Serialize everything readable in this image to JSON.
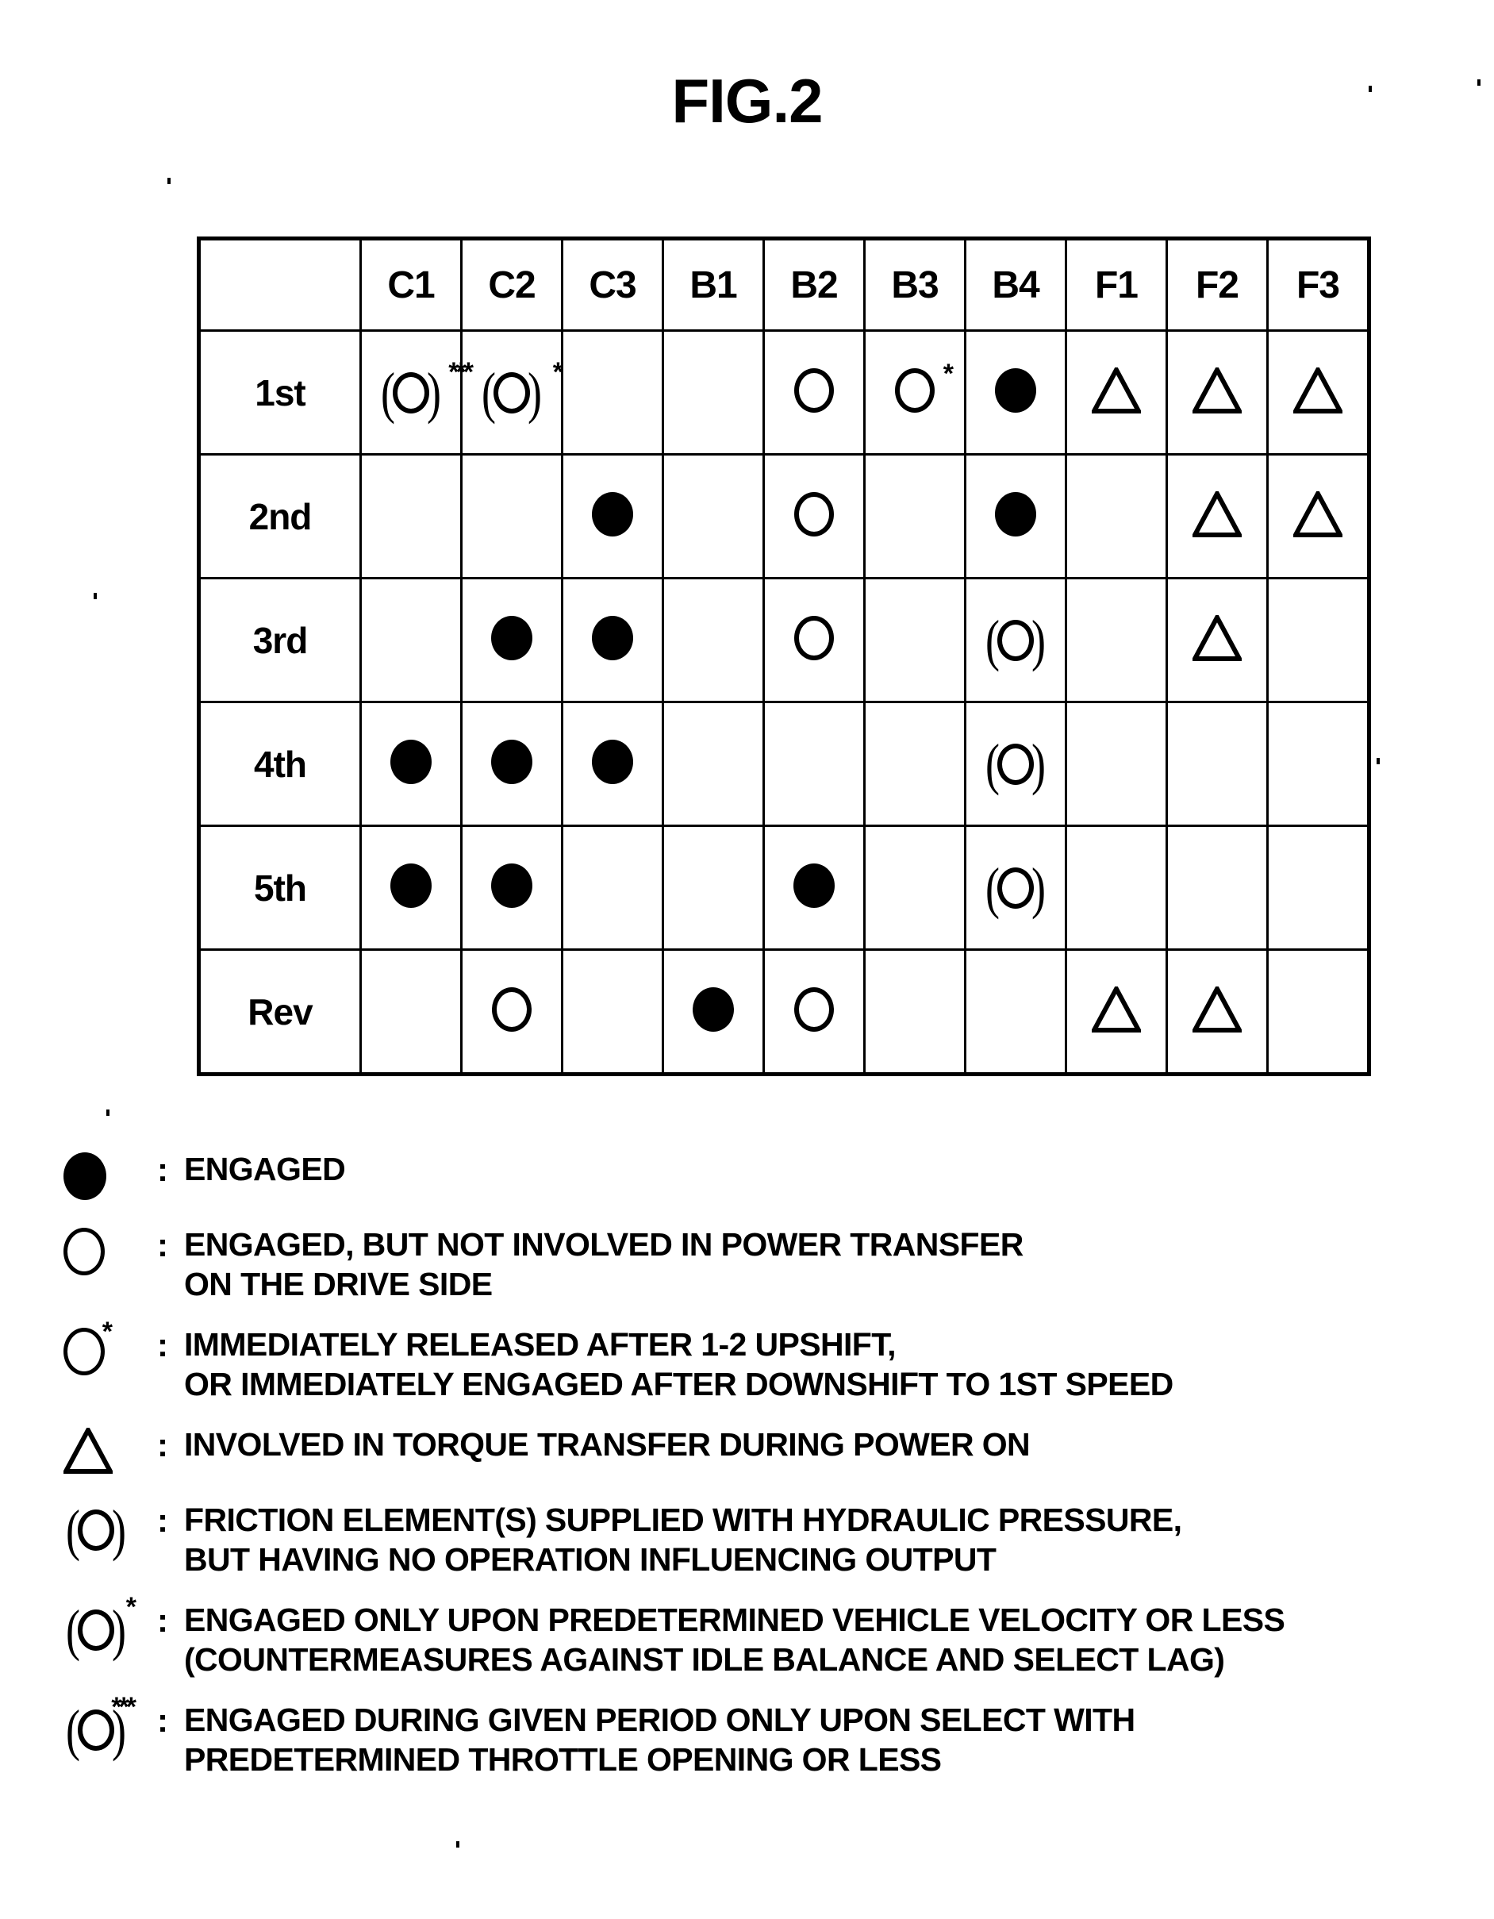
{
  "figure": {
    "title": "FIG.2"
  },
  "table": {
    "corner_label": "",
    "columns": [
      "C1",
      "C2",
      "C3",
      "B1",
      "B2",
      "B3",
      "B4",
      "F1",
      "F2",
      "F3"
    ],
    "row_labels": [
      "1st",
      "2nd",
      "3rd",
      "4th",
      "5th",
      "Rev"
    ],
    "symbol_legend_keys": {
      "filled": "filled-circle",
      "open": "open-circle",
      "open_star": "open-circle-asterisk",
      "triangle": "triangle",
      "paren": "paren-circle",
      "paren_star": "paren-circle-asterisk",
      "paren_star3": "paren-circle-triple-asterisk",
      "empty": ""
    },
    "rows": [
      {
        "label": "1st",
        "cells": [
          "paren_star3",
          "paren_star",
          "",
          "",
          "open",
          "open_star",
          "filled",
          "triangle",
          "triangle",
          "triangle"
        ]
      },
      {
        "label": "2nd",
        "cells": [
          "",
          "",
          "filled",
          "",
          "open",
          "",
          "filled",
          "",
          "triangle",
          "triangle"
        ]
      },
      {
        "label": "3rd",
        "cells": [
          "",
          "filled",
          "filled",
          "",
          "open",
          "",
          "paren",
          "",
          "triangle",
          ""
        ]
      },
      {
        "label": "4th",
        "cells": [
          "filled",
          "filled",
          "filled",
          "",
          "",
          "",
          "paren",
          "",
          "",
          ""
        ]
      },
      {
        "label": "5th",
        "cells": [
          "filled",
          "filled",
          "",
          "",
          "filled",
          "",
          "paren",
          "",
          "",
          ""
        ]
      },
      {
        "label": "Rev",
        "cells": [
          "",
          "open",
          "",
          "filled",
          "open",
          "",
          "",
          "triangle",
          "triangle",
          ""
        ]
      }
    ]
  },
  "legend": {
    "colon": ":",
    "items": [
      {
        "symbol": "filled-circle",
        "stars": "",
        "text": "ENGAGED"
      },
      {
        "symbol": "open-circle",
        "stars": "",
        "text": "ENGAGED, BUT NOT INVOLVED IN POWER TRANSFER\nON THE DRIVE SIDE"
      },
      {
        "symbol": "open-circle",
        "stars": "*",
        "text": "IMMEDIATELY RELEASED AFTER 1-2 UPSHIFT,\nOR IMMEDIATELY ENGAGED AFTER DOWNSHIFT TO 1ST SPEED"
      },
      {
        "symbol": "triangle",
        "stars": "",
        "text": "INVOLVED IN TORQUE TRANSFER DURING POWER ON"
      },
      {
        "symbol": "paren-circle",
        "stars": "",
        "text": "FRICTION ELEMENT(S) SUPPLIED WITH HYDRAULIC PRESSURE,\nBUT HAVING NO OPERATION INFLUENCING OUTPUT"
      },
      {
        "symbol": "paren-circle",
        "stars": "*",
        "text": "ENGAGED ONLY UPON PREDETERMINED VEHICLE VELOCITY OR LESS\n(COUNTERMEASURES AGAINST IDLE BALANCE AND SELECT LAG)"
      },
      {
        "symbol": "paren-circle",
        "stars": "***",
        "text": "ENGAGED DURING GIVEN PERIOD ONLY UPON SELECT WITH\nPREDETERMINED THROTTLE OPENING OR LESS"
      }
    ]
  },
  "colors": {
    "ink": "#000000",
    "page": "#ffffff"
  }
}
